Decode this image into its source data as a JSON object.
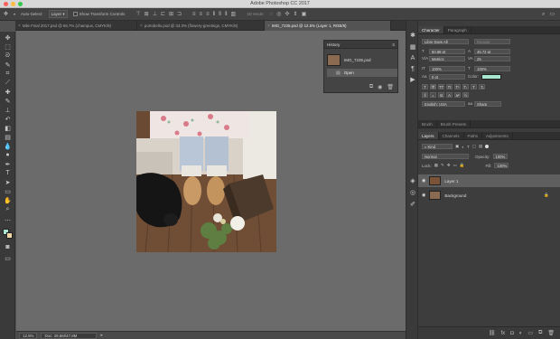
{
  "window": {
    "title": "Adobe Photoshop CC 2017",
    "traffic_colors": [
      "#fc605b",
      "#fdbc40",
      "#34c84a"
    ]
  },
  "options": {
    "autoselect_label": "Auto-Select:",
    "autoselect_value": "Layer",
    "show_transform_label": "Show Transform Controls",
    "mode_3d_label": "3D Mode:"
  },
  "doc_tabs": [
    {
      "label": "Mile Final 2017.psd @ 66.7% (champus, CMYK/8)"
    },
    {
      "label": "portobello.psd @ 33.3% (flowery-greetings, CMYK/8)"
    },
    {
      "label": "IMG_7235.psd @ 12.5% (Layer 1, RGB/8)"
    }
  ],
  "history": {
    "title": "History",
    "snapshot": "IMG_7235.psd",
    "steps": [
      "Open"
    ]
  },
  "character": {
    "tabs": [
      "Character",
      "Paragraph"
    ],
    "font_family": "Libre Days All",
    "font_style": "Regular",
    "font_size": "60,88 pt",
    "leading": "45,72 pt",
    "kerning": "Metrics",
    "tracking": "25",
    "vscale": "100%",
    "hscale": "100%",
    "baseline": "0 pt",
    "color_label": "Color:",
    "color_swatch": "#a8e6cf",
    "language": "English: USA",
    "aa": "Sharp"
  },
  "brush_tabs": [
    "Brush",
    "Brush Presets"
  ],
  "layers": {
    "tabs": [
      "Layers",
      "Channels",
      "Paths",
      "Adjustments"
    ],
    "filter": "Kind",
    "blend": "Normal",
    "opacity_label": "Opacity:",
    "opacity": "100%",
    "lock_label": "Lock:",
    "fill_label": "Fill:",
    "fill": "100%",
    "items": [
      {
        "name": "Layer 1"
      },
      {
        "name": "Background"
      }
    ]
  },
  "status": {
    "zoom": "12.5%",
    "doc": "Doc: 29,5M/47,8M"
  }
}
